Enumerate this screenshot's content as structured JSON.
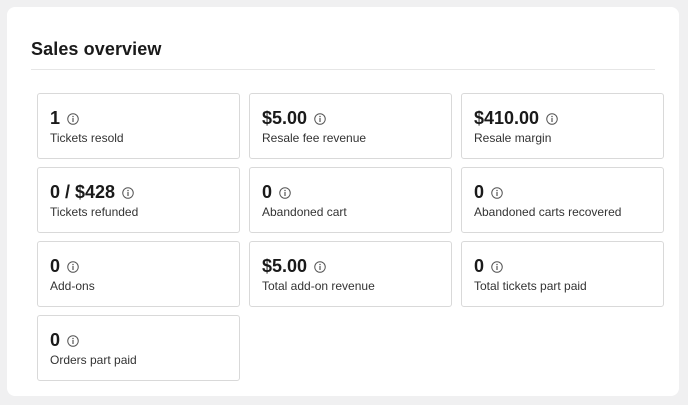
{
  "header": {
    "title": "Sales overview"
  },
  "stats": [
    {
      "value": "1",
      "label": "Tickets resold",
      "icon": "info-icon"
    },
    {
      "value": "$5.00",
      "label": "Resale fee revenue",
      "icon": "info-icon"
    },
    {
      "value": "$410.00",
      "label": "Resale margin",
      "icon": "info-icon"
    },
    {
      "value": "0 / $428",
      "label": "Tickets refunded",
      "icon": "info-icon"
    },
    {
      "value": "0",
      "label": "Abandoned cart",
      "icon": "info-icon"
    },
    {
      "value": "0",
      "label": "Abandoned carts recovered",
      "icon": "info-icon"
    },
    {
      "value": "0",
      "label": "Add-ons",
      "icon": "info-icon"
    },
    {
      "value": "$5.00",
      "label": "Total add-on revenue",
      "icon": "info-icon"
    },
    {
      "value": "0",
      "label": "Total tickets part paid",
      "icon": "info-icon"
    },
    {
      "value": "0",
      "label": "Orders part paid",
      "icon": "info-icon"
    }
  ],
  "colors": {
    "page_background": "#f0f0f1",
    "card_background": "#ffffff",
    "border": "#d9d9d9",
    "text": "#1a1a1a"
  }
}
